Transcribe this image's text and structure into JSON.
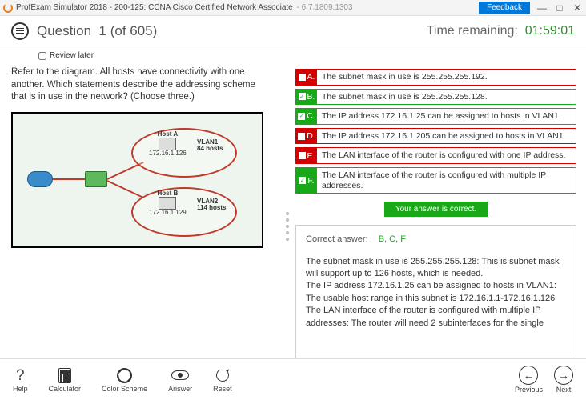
{
  "titlebar": {
    "app": "ProfExam Simulator 2018",
    "exam": "200-125: CCNA Cisco Certified Network Associate",
    "build": "6.7.1809.1303",
    "feedback": "Feedback"
  },
  "header": {
    "question_label": "Question",
    "question_num": "1",
    "question_total": "(of 605)",
    "timer_label": "Time remaining:",
    "timer_value": "01:59:01"
  },
  "review_label": "Review later",
  "question_text": "Refer to the diagram. All hosts have connectivity with one another. Which statements describe the addressing scheme that is in use in the network? (Choose three.)",
  "diagram": {
    "host_a": "Host A",
    "host_b": "Host B",
    "ip_a": "172.16.1.126",
    "ip_b": "172.16.1.129",
    "vlan1_name": "VLAN1",
    "vlan1_hosts": "84 hosts",
    "vlan2_name": "VLAN2",
    "vlan2_hosts": "114 hosts"
  },
  "options": [
    {
      "letter": "A.",
      "text": "The subnet mask in use is 255.255.255.192.",
      "correct": false,
      "checked": false
    },
    {
      "letter": "B.",
      "text": "The subnet mask in use is 255.255.255.128.",
      "correct": true,
      "checked": true
    },
    {
      "letter": "C.",
      "text": "The IP address 172.16.1.25 can be assigned to hosts in VLAN1",
      "correct": true,
      "checked": true
    },
    {
      "letter": "D.",
      "text": "The IP address 172.16.1.205 can be assigned to hosts in VLAN1",
      "correct": false,
      "checked": false
    },
    {
      "letter": "E.",
      "text": "The LAN interface of the router is configured with one IP address.",
      "correct": false,
      "checked": false
    },
    {
      "letter": "F.",
      "text": "The LAN interface of the router is configured with multiple IP addresses.",
      "correct": true,
      "checked": true
    }
  ],
  "banner": "Your answer is correct.",
  "correct_label": "Correct answer:",
  "correct_value": "B, C, F",
  "explanation": "The subnet mask in use is 255.255.255.128: This is subnet mask will support up to 126 hosts, which is needed.\nThe IP address 172.16.1.25 can be assigned to hosts in VLAN1: The usable host range in this subnet is 172.16.1.1-172.16.1.126\nThe LAN interface of the router is configured with multiple IP addresses: The router will need 2 subinterfaces for the single",
  "footer": {
    "help": "Help",
    "calc": "Calculator",
    "color": "Color Scheme",
    "answer": "Answer",
    "reset": "Reset",
    "prev": "Previous",
    "next": "Next"
  }
}
